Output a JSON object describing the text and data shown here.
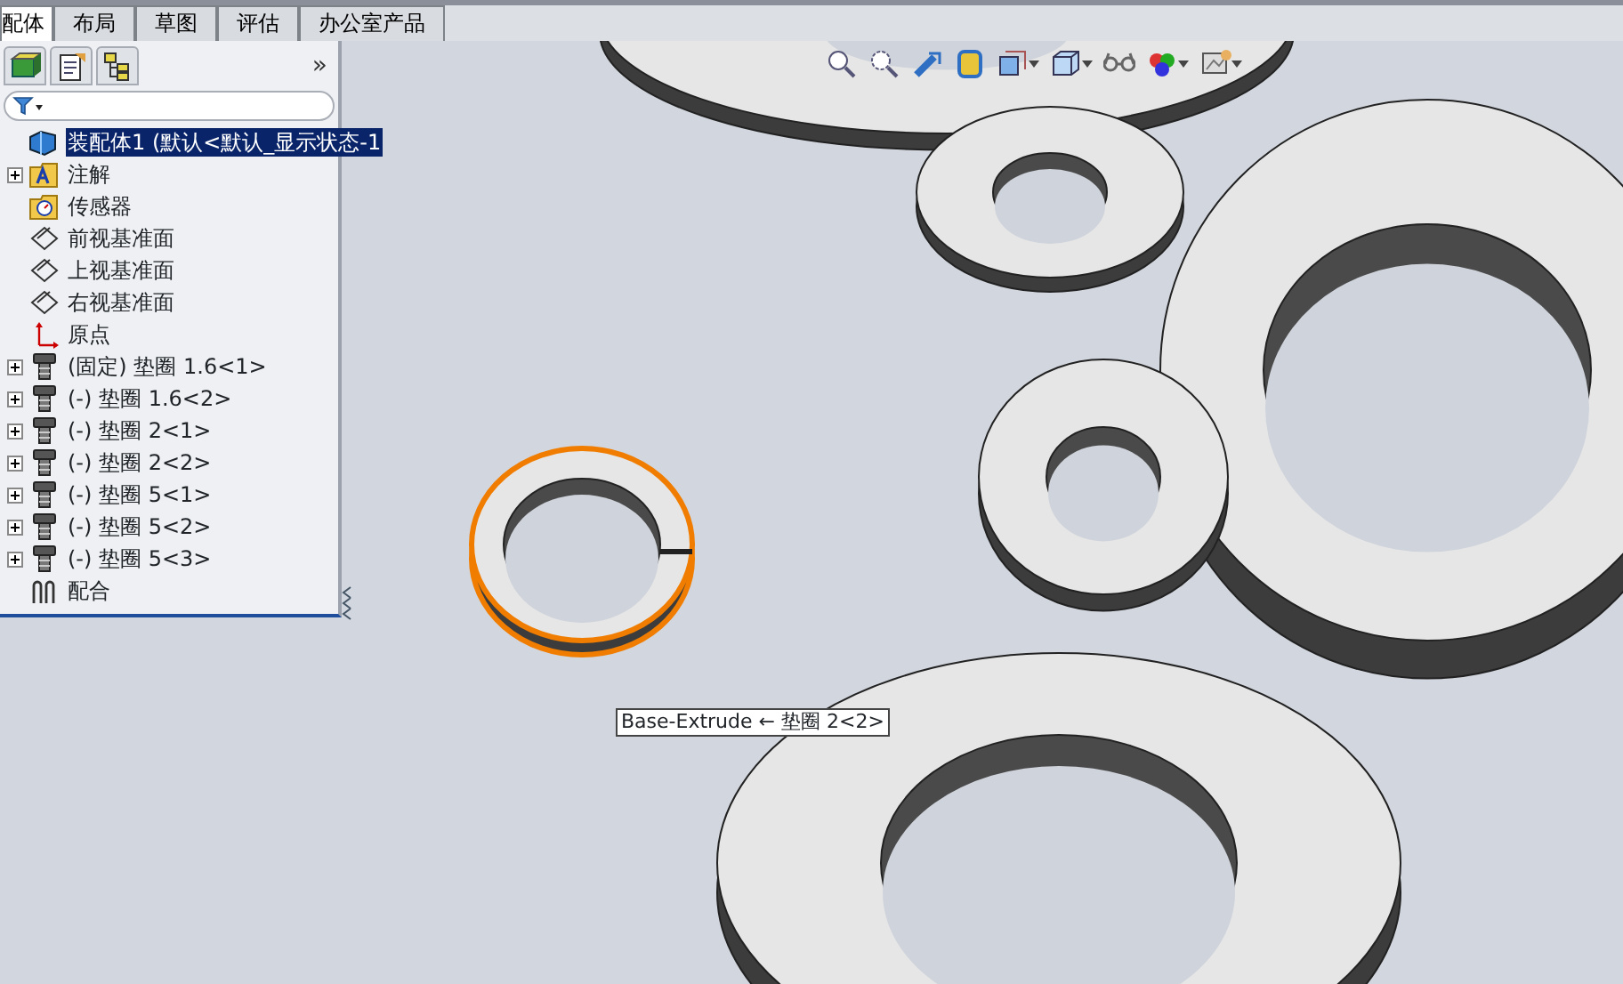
{
  "tabs": [
    {
      "label": "配体",
      "selected": true
    },
    {
      "label": "布局",
      "selected": false
    },
    {
      "label": "草图",
      "selected": false
    },
    {
      "label": "评估",
      "selected": false
    },
    {
      "label": "办公室产品",
      "selected": false
    }
  ],
  "panel": {
    "more": "»",
    "tree": [
      {
        "label": "装配体1 (默认<默认_显示状态-1",
        "kind": "assembly",
        "expander": false,
        "selected": true
      },
      {
        "label": "注解",
        "kind": "annotation",
        "expander": true,
        "selected": false
      },
      {
        "label": "传感器",
        "kind": "sensor",
        "expander": false,
        "selected": false
      },
      {
        "label": "前视基准面",
        "kind": "plane",
        "expander": false,
        "selected": false
      },
      {
        "label": "上视基准面",
        "kind": "plane",
        "expander": false,
        "selected": false
      },
      {
        "label": "右视基准面",
        "kind": "plane",
        "expander": false,
        "selected": false
      },
      {
        "label": "原点",
        "kind": "origin",
        "expander": false,
        "selected": false
      },
      {
        "label": "(固定) 垫圈 1.6<1>",
        "kind": "part",
        "expander": true,
        "selected": false
      },
      {
        "label": "(-) 垫圈 1.6<2>",
        "kind": "part",
        "expander": true,
        "selected": false
      },
      {
        "label": "(-) 垫圈 2<1>",
        "kind": "part",
        "expander": true,
        "selected": false
      },
      {
        "label": "(-) 垫圈 2<2>",
        "kind": "part",
        "expander": true,
        "selected": false
      },
      {
        "label": "(-) 垫圈 5<1>",
        "kind": "part",
        "expander": true,
        "selected": false
      },
      {
        "label": "(-) 垫圈 5<2>",
        "kind": "part",
        "expander": true,
        "selected": false
      },
      {
        "label": "(-) 垫圈 5<3>",
        "kind": "part",
        "expander": true,
        "selected": false
      },
      {
        "label": "配合",
        "kind": "mates",
        "expander": false,
        "selected": false
      }
    ]
  },
  "viewport": {
    "washers": [
      {
        "selected": false
      },
      {
        "selected": false
      },
      {
        "selected": false
      },
      {
        "selected": false
      },
      {
        "selected": true
      },
      {
        "selected": false
      }
    ],
    "tooltip": "Base-Extrude ← 垫圈 2<2>"
  }
}
